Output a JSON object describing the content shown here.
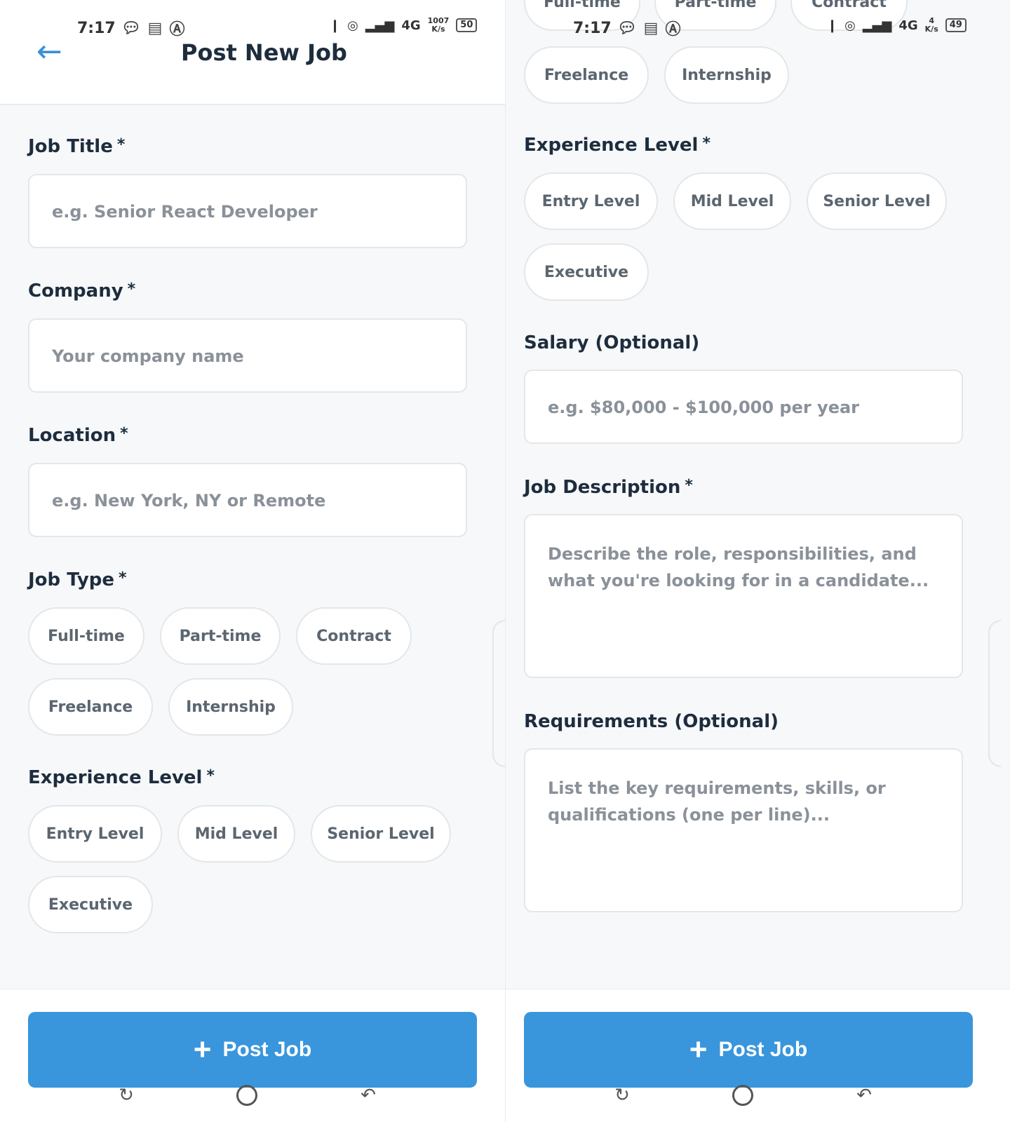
{
  "status_left": {
    "time": "7:17",
    "battery": "50",
    "net": "1007",
    "net_unit": "K/s",
    "net_type": "4G"
  },
  "status_right": {
    "time": "7:17",
    "battery": "49",
    "net": "4",
    "net_unit": "K/s",
    "net_type": "4G"
  },
  "header": {
    "title": "Post New Job"
  },
  "form": {
    "job_title": {
      "label": "Job Title",
      "required": "*",
      "placeholder": "e.g. Senior React Developer"
    },
    "company": {
      "label": "Company",
      "required": "*",
      "placeholder": "Your company name"
    },
    "location": {
      "label": "Location",
      "required": "*",
      "placeholder": "e.g. New York, NY or Remote"
    },
    "job_type": {
      "label": "Job Type",
      "required": "*",
      "options": [
        "Full-time",
        "Part-time",
        "Contract",
        "Freelance",
        "Internship"
      ]
    },
    "experience": {
      "label": "Experience Level",
      "required": "*",
      "options": [
        "Entry Level",
        "Mid Level",
        "Senior Level",
        "Executive"
      ]
    },
    "salary": {
      "label": "Salary (Optional)",
      "placeholder": "e.g. $80,000 - $100,000 per year"
    },
    "description": {
      "label": "Job Description",
      "required": "*",
      "placeholder": "Describe the role, responsibilities, and what you're looking for in a candidate..."
    },
    "requirements": {
      "label": "Requirements (Optional)",
      "placeholder": "List the key requirements, skills, or qualifications (one per line)..."
    }
  },
  "actions": {
    "post_label": "Post Job",
    "post_icon": "plus-icon"
  },
  "colors": {
    "accent": "#3996dd",
    "text": "#1e2d3d",
    "placeholder": "#8a9199",
    "background": "#f6f8fa"
  }
}
